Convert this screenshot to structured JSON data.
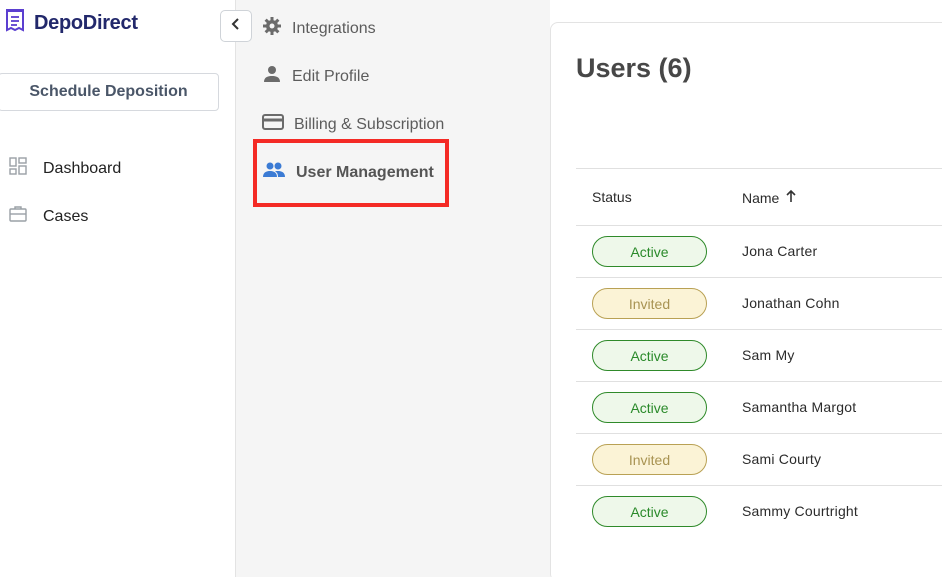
{
  "brand": {
    "name": "DepoDirect"
  },
  "sidebar": {
    "schedule_label": "Schedule Deposition",
    "items": [
      {
        "label": "Dashboard",
        "icon": "dashboard-icon"
      },
      {
        "label": "Cases",
        "icon": "briefcase-icon"
      }
    ]
  },
  "settings": {
    "items": [
      {
        "label": "Integrations",
        "icon": "gear-icon"
      },
      {
        "label": "Edit Profile",
        "icon": "person-icon"
      },
      {
        "label": "Billing & Subscription",
        "icon": "credit-card-icon"
      },
      {
        "label": "User Management",
        "icon": "people-icon",
        "active": true
      }
    ]
  },
  "main": {
    "title": "Users (6)",
    "columns": {
      "status": "Status",
      "name": "Name"
    },
    "rows": [
      {
        "status": "Active",
        "name": "Jona Carter"
      },
      {
        "status": "Invited",
        "name": "Jonathan Cohn"
      },
      {
        "status": "Active",
        "name": "Sam My"
      },
      {
        "status": "Active",
        "name": "Samantha Margot"
      },
      {
        "status": "Invited",
        "name": "Sami Courty"
      },
      {
        "status": "Active",
        "name": "Sammy Courtright"
      }
    ]
  },
  "colors": {
    "brand": "#22286b",
    "active_icon": "#3b7bd4",
    "highlight": "#f42a25",
    "active_badge": "#2a8a2a",
    "invited_badge": "#a89352"
  }
}
